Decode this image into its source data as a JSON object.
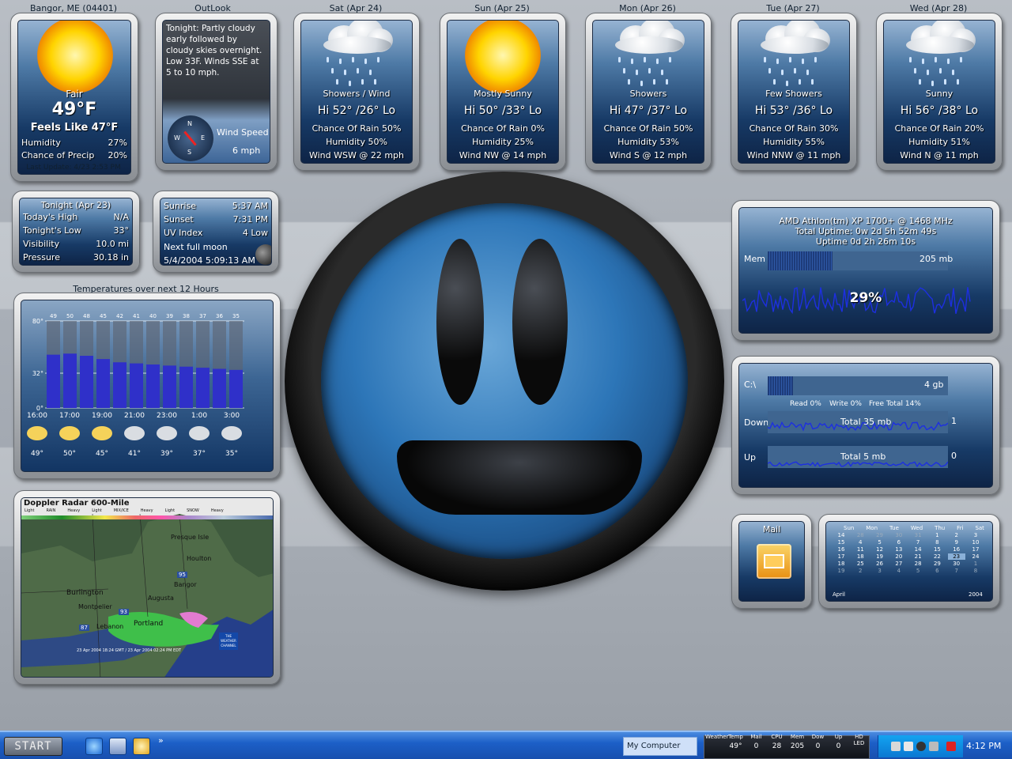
{
  "current": {
    "location": "Bangor, ME (04401)",
    "condition": "Fair",
    "temp": "49°F",
    "feels": "Feels Like 47°F",
    "humidity_label": "Humidity",
    "humidity": "27%",
    "precip_label": "Chance of Precip",
    "precip": "20%",
    "update": "Last Update: 4/23 2:53 PM"
  },
  "outlook": {
    "title": "OutLook",
    "text": "Tonight: Partly cloudy early followed by cloudy skies overnight. Low 33F. Winds SSE at 5 to 10 mph.",
    "wind_label": "Wind Speed",
    "wind": "6 mph",
    "compass": {
      "n": "N",
      "s": "S",
      "e": "E",
      "w": "W"
    }
  },
  "forecast": [
    {
      "day": "Sat (Apr 24)",
      "cond": "Showers / Wind",
      "hi": "Hi 52° /26° Lo",
      "rain": "Chance Of Rain 50%",
      "hum": "Humidity 50%",
      "wind": "Wind WSW @ 22 mph",
      "icon": "rain-cloud"
    },
    {
      "day": "Sun (Apr 25)",
      "cond": "Mostly Sunny",
      "hi": "Hi 50° /33° Lo",
      "rain": "Chance Of Rain 0%",
      "hum": "Humidity 25%",
      "wind": "Wind NW @ 14 mph",
      "icon": "sun"
    },
    {
      "day": "Mon (Apr 26)",
      "cond": "Showers",
      "hi": "Hi 47° /37° Lo",
      "rain": "Chance Of Rain 50%",
      "hum": "Humidity 53%",
      "wind": "Wind S @ 12 mph",
      "icon": "rain-cloud"
    },
    {
      "day": "Tue (Apr 27)",
      "cond": "Few Showers",
      "hi": "Hi 53° /36° Lo",
      "rain": "Chance Of Rain 30%",
      "hum": "Humidity 55%",
      "wind": "Wind NNW @ 11 mph",
      "icon": "rain-cloud"
    },
    {
      "day": "Wed (Apr 28)",
      "cond": "Sunny",
      "hi": "Hi 56° /38° Lo",
      "rain": "Chance Of Rain 20%",
      "hum": "Humidity 51%",
      "wind": "Wind N @ 11 mph",
      "icon": "rain-cloud"
    }
  ],
  "tonight": {
    "title": "Tonight (Apr 23)",
    "rows": [
      {
        "label": "Today's High",
        "value": "N/A"
      },
      {
        "label": "Tonight's Low",
        "value": "33°"
      },
      {
        "label": "Visibility",
        "value": "10.0 mi"
      },
      {
        "label": "Pressure",
        "value": "30.18 in"
      }
    ]
  },
  "sun": {
    "sunrise_label": "Sunrise",
    "sunrise": "5:37 AM",
    "sunset_label": "Sunset",
    "sunset": "7:31 PM",
    "uv_label": "UV Index",
    "uv": "4 Low",
    "moon_label": "Next full moon",
    "moon": "5/4/2004 5:09:13 AM"
  },
  "temps12": {
    "title": "Temperatures over next 12 Hours",
    "ylabels": [
      "80°",
      "32°",
      "0°"
    ],
    "values": [
      49,
      50,
      48,
      45,
      42,
      41,
      40,
      39,
      38,
      37,
      36,
      35
    ],
    "times": [
      "16:00",
      "17:00",
      "19:00",
      "21:00",
      "23:00",
      "1:00",
      "3:00"
    ],
    "icon_temps": [
      "49°",
      "50°",
      "45°",
      "41°",
      "39°",
      "37°",
      "35°"
    ]
  },
  "radar": {
    "title": "Doppler Radar 600-Mile",
    "legend": [
      "Light",
      "RAIN",
      "Heavy",
      "Light",
      "MIX/ICE",
      "Heavy",
      "Light",
      "SNOW",
      "Heavy"
    ],
    "places": [
      "Presque Isle",
      "Houlton",
      "Bangor",
      "Augusta",
      "Burlington",
      "Montpelier",
      "Portland",
      "Lebanon"
    ],
    "roads": [
      "95",
      "93",
      "87"
    ],
    "stamp": "23 Apr 2004 18:24 GMT / 23 Apr 2004 02:24 PM EDT",
    "logo": "THE WEATHER CHANNEL"
  },
  "system": {
    "cpu": "AMD Athlon(tm) XP 1700+ @ 1468 MHz",
    "uptime_total": "Total Uptime: 0w 2d 5h 52m 49s",
    "uptime": "Uptime 0d 2h 26m 10s",
    "mem_label": "Mem",
    "mem": "205 mb",
    "cpu_pct": "29%",
    "mem_fill": 0.36
  },
  "disk": {
    "drive": "C:\\",
    "free": "4 gb",
    "read": "Read 0%",
    "write": "Write 0%",
    "free_total": "Free Total 14%",
    "down_label": "Down",
    "down_total": "Total  35 mb",
    "down_val": "1",
    "up_label": "Up",
    "up_total": "Total  5 mb",
    "up_val": "0",
    "fill": 0.14
  },
  "mail": {
    "label": "Mail"
  },
  "calendar": {
    "days": [
      "Sun",
      "Mon",
      "Tue",
      "Wed",
      "Thu",
      "Fri",
      "Sat"
    ],
    "weeks": [
      [
        "28",
        "29",
        "29",
        "30",
        "31",
        "1",
        "2",
        "3"
      ],
      [
        "",
        "4",
        "5",
        "6",
        "7",
        "8",
        "9",
        "10"
      ]
    ],
    "rows": [
      [
        "14",
        "15",
        "16",
        "17",
        "18",
        "19"
      ],
      [
        "4",
        "5",
        "6",
        "7",
        "8",
        "9",
        "10"
      ]
    ],
    "month": "April",
    "year": "2004"
  },
  "taskbar": {
    "start": "START",
    "mycomputer": "My Computer",
    "tray_labels": [
      "Weather",
      "Temp",
      "Mail",
      "CPU",
      "Mem",
      "Dow",
      "Up",
      "HD LED"
    ],
    "tray_values": [
      "",
      "49°",
      "0",
      "28",
      "205",
      "0",
      "0",
      ""
    ],
    "clock": "4:12 PM"
  },
  "colors": {
    "panel": "#1f4a7c",
    "accent": "#2b3fd0",
    "desktop": "#adb3bb"
  }
}
